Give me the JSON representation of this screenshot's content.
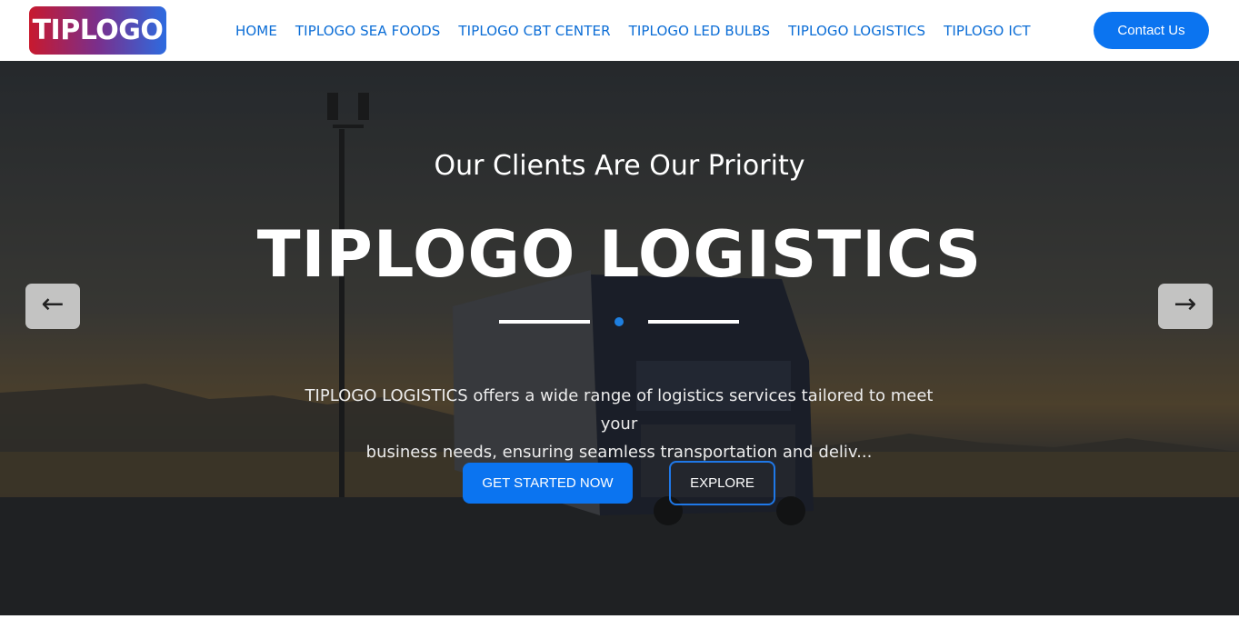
{
  "brand": {
    "logo_text": "TIPLOGO"
  },
  "nav": {
    "items": [
      {
        "label": "HOME"
      },
      {
        "label": "TIPLOGO SEA FOODS"
      },
      {
        "label": "TIPLOGO CBT CENTER"
      },
      {
        "label": "TIPLOGO LED BULBS"
      },
      {
        "label": "TIPLOGO LOGISTICS"
      },
      {
        "label": "TIPLOGO ICT"
      }
    ],
    "contact_label": "Contact Us"
  },
  "hero": {
    "subtitle": "Our Clients Are Our Priority",
    "title": "TIPLOGO LOGISTICS",
    "description_line1": "TIPLOGO LOGISTICS offers a wide range of logistics services tailored to meet your",
    "description_line2": "business needs, ensuring seamless transportation and deliv...",
    "primary_button": "GET STARTED NOW",
    "secondary_button": "EXPLORE",
    "prev_icon": "←",
    "next_icon": "→"
  },
  "colors": {
    "accent": "#0b74f0",
    "nav_text": "#0b6dd6",
    "logo_gradient_start": "#c8192e",
    "logo_gradient_end": "#2d6be0"
  },
  "icons": {
    "prev": "arrow-left-icon",
    "next": "arrow-right-icon"
  }
}
